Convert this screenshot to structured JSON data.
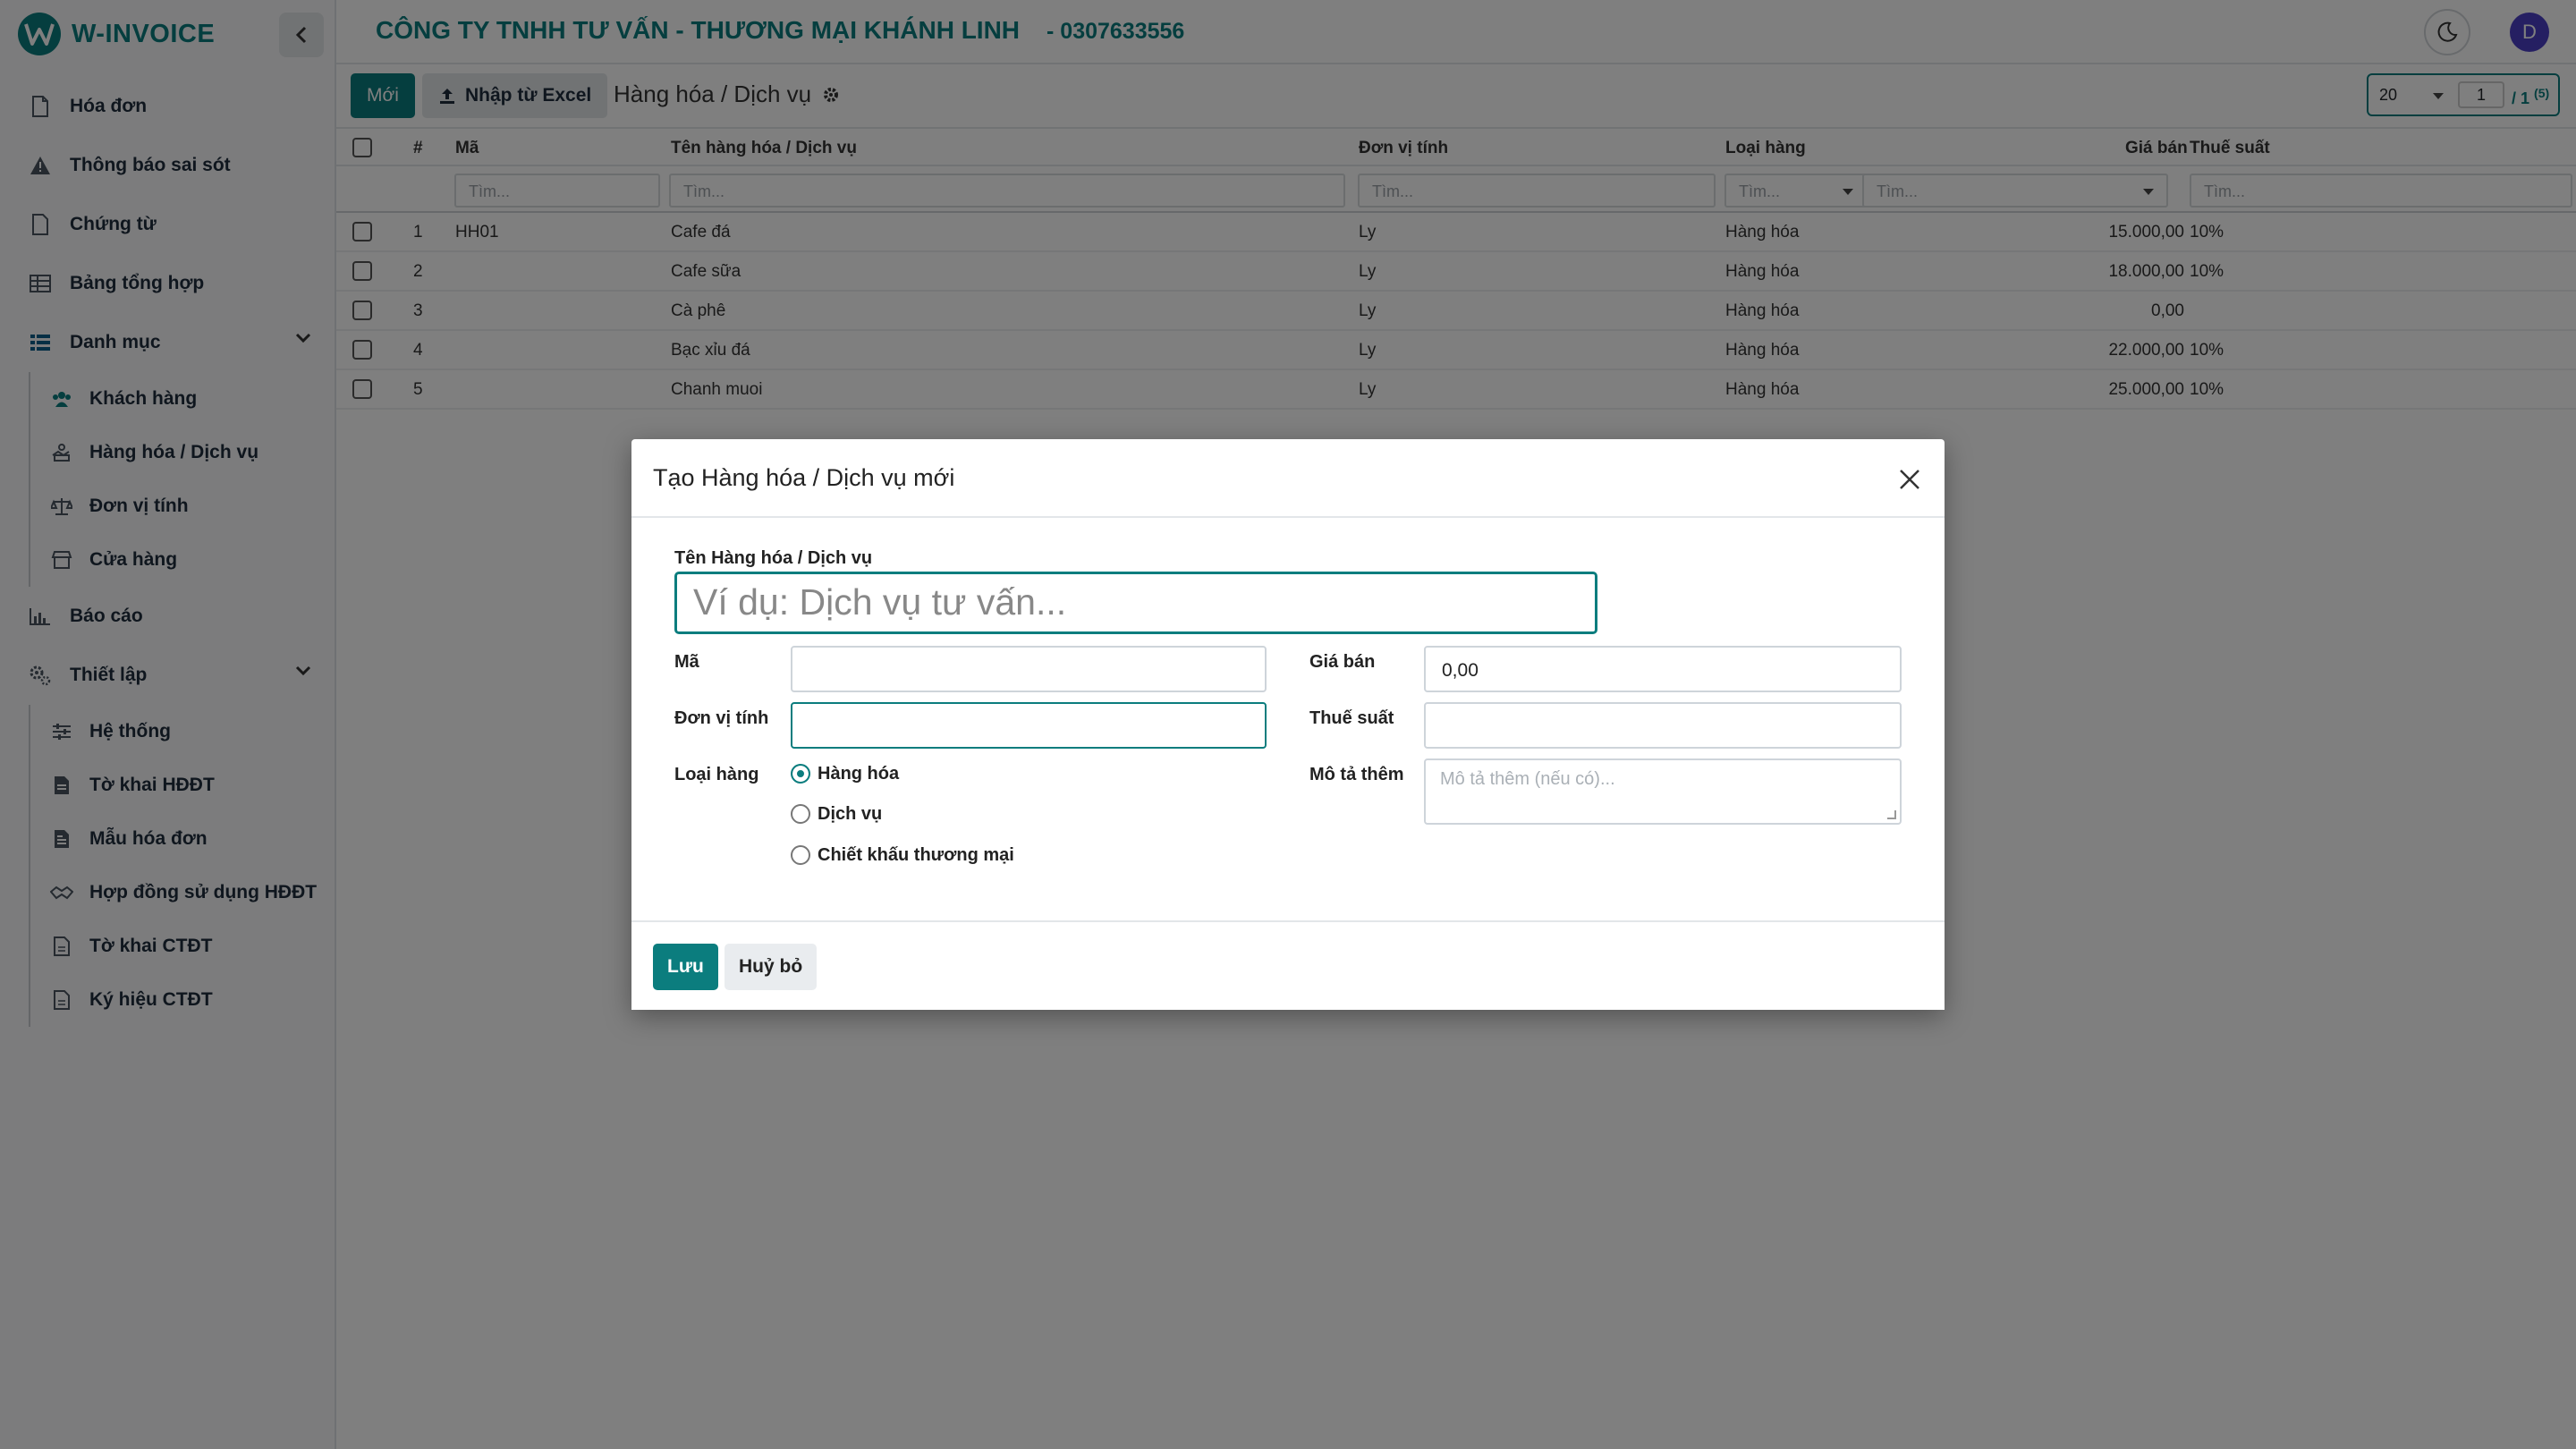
{
  "brand": {
    "name": "W-INVOICE"
  },
  "header": {
    "company": "CÔNG TY TNHH TƯ VẤN - THƯƠNG MẠI KHÁNH LINH",
    "tax_code": "- 0307633556",
    "avatar_initial": "D"
  },
  "sidebar": {
    "items": [
      {
        "label": "Hóa đơn",
        "icon": "file-icon"
      },
      {
        "label": "Thông báo sai sót",
        "icon": "warning-icon"
      },
      {
        "label": "Chứng từ",
        "icon": "document-icon"
      },
      {
        "label": "Bảng tổng hợp",
        "icon": "table-icon"
      },
      {
        "label": "Danh mục",
        "icon": "list-icon"
      }
    ],
    "danh_muc_children": [
      {
        "label": "Khách hàng",
        "icon": "users-icon"
      },
      {
        "label": "Hàng hóa / Dịch vụ",
        "icon": "box-icon"
      },
      {
        "label": "Đơn vị tính",
        "icon": "scale-icon"
      },
      {
        "label": "Cửa hàng",
        "icon": "store-icon"
      }
    ],
    "items2": [
      {
        "label": "Báo cáo",
        "icon": "chart-icon"
      },
      {
        "label": "Thiết lập",
        "icon": "cogs-icon"
      }
    ],
    "thiet_lap_children": [
      {
        "label": "Hệ thống",
        "icon": "sliders-icon"
      },
      {
        "label": "Tờ khai HĐĐT",
        "icon": "file-text-icon"
      },
      {
        "label": "Mẫu hóa đơn",
        "icon": "invoice-icon"
      },
      {
        "label": "Hợp đồng sử dụng HĐĐT",
        "icon": "handshake-icon"
      },
      {
        "label": "Tờ khai CTĐT",
        "icon": "file-icon"
      },
      {
        "label": "Ký hiệu CTĐT",
        "icon": "file-icon"
      }
    ]
  },
  "toolbar": {
    "new_label": "Mới",
    "import_label": "Nhập từ Excel",
    "breadcrumb": "Hàng hóa / Dịch vụ",
    "page_size": "20",
    "page": "1",
    "total_pages": "/ 1",
    "total_records": "(5)"
  },
  "table": {
    "columns": {
      "index": "#",
      "code": "Mã",
      "name": "Tên hàng hóa / Dịch vụ",
      "unit": "Đơn vị tính",
      "type": "Loại hàng",
      "price": "Giá bán",
      "tax": "Thuế suất"
    },
    "filter_placeholder": "Tìm...",
    "rows": [
      {
        "index": "1",
        "code": "HH01",
        "name": "Cafe đá",
        "unit": "Ly",
        "type": "Hàng hóa",
        "price": "15.000,00",
        "tax": "10%"
      },
      {
        "index": "2",
        "code": "",
        "name": "Cafe sữa",
        "unit": "Ly",
        "type": "Hàng hóa",
        "price": "18.000,00",
        "tax": "10%"
      },
      {
        "index": "3",
        "code": "",
        "name": "Cà phê",
        "unit": "Ly",
        "type": "Hàng hóa",
        "price": "0,00",
        "tax": ""
      },
      {
        "index": "4",
        "code": "",
        "name": "Bạc xỉu đá",
        "unit": "Ly",
        "type": "Hàng hóa",
        "price": "22.000,00",
        "tax": "10%"
      },
      {
        "index": "5",
        "code": "",
        "name": "Chanh muoi",
        "unit": "Ly",
        "type": "Hàng hóa",
        "price": "25.000,00",
        "tax": "10%"
      }
    ]
  },
  "modal": {
    "title": "Tạo Hàng hóa / Dịch vụ mới",
    "name_label": "Tên Hàng hóa / Dịch vụ",
    "name_placeholder": "Ví dụ: Dịch vụ tư vấn...",
    "code_label": "Mã",
    "code_value": "",
    "unit_label": "Đơn vị tính",
    "unit_value": "",
    "type_label": "Loại hàng",
    "type_options": [
      "Hàng hóa",
      "Dịch vụ",
      "Chiết khấu thương mại"
    ],
    "type_selected": "Hàng hóa",
    "price_label": "Giá bán",
    "price_value": "0,00",
    "tax_label": "Thuế suất",
    "tax_value": "",
    "desc_label": "Mô tả thêm",
    "desc_placeholder": "Mô tả thêm (nếu có)...",
    "save_label": "Lưu",
    "cancel_label": "Huỷ bỏ"
  },
  "colors": {
    "brand": "#0b7d7e",
    "avatar": "#4b3fc4"
  }
}
